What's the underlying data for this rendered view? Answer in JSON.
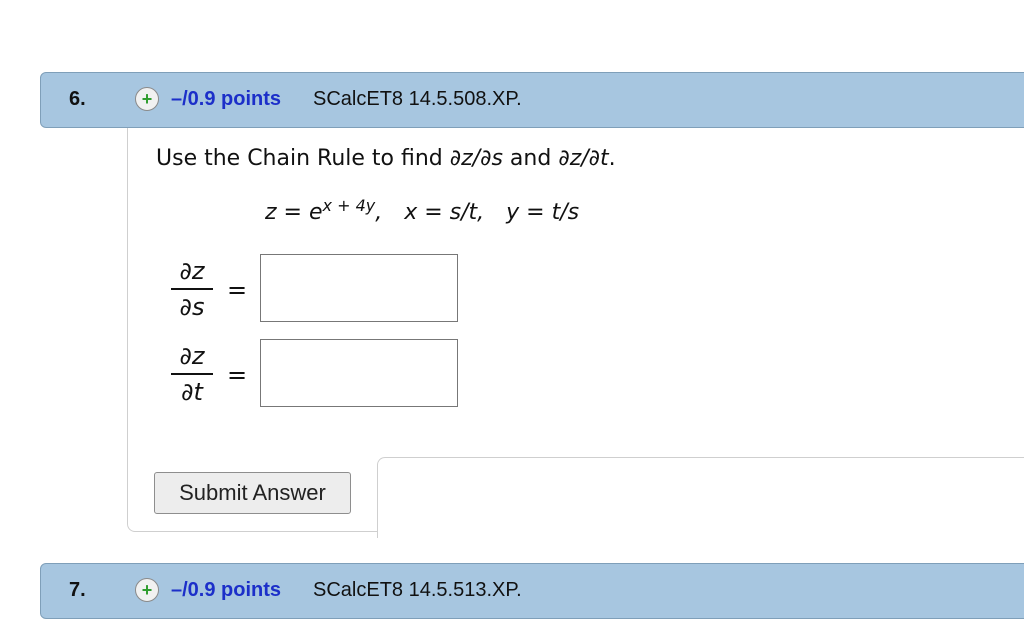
{
  "question6": {
    "number": "6.",
    "points": "–/0.9 points",
    "code": "SCalcET8 14.5.508.XP.",
    "instruction": {
      "part1": "Use the Chain Rule to find ",
      "dzds": "∂z/∂s",
      "and": " and ",
      "dzdt": "∂z/∂t",
      "end": "."
    },
    "equation": {
      "z_lhs": "z = e",
      "z_exp": "x + 4y",
      "comma1": ",",
      "x_def": "x = s/t,",
      "y_def": "y = t/s"
    },
    "partials": [
      {
        "numerator": "∂z",
        "denominator": "∂s",
        "equals": "=",
        "answer": ""
      },
      {
        "numerator": "∂z",
        "denominator": "∂t",
        "equals": "=",
        "answer": ""
      }
    ],
    "submit_label": "Submit Answer"
  },
  "question7": {
    "number": "7.",
    "points": "–/0.9 points",
    "code": "SCalcET8 14.5.513.XP."
  },
  "colors": {
    "header_bg": "#a7c6e0",
    "points_blue": "#1c2fc9",
    "plus_green": "#2f9d2f"
  },
  "icons": {
    "expand": "plus-icon"
  }
}
